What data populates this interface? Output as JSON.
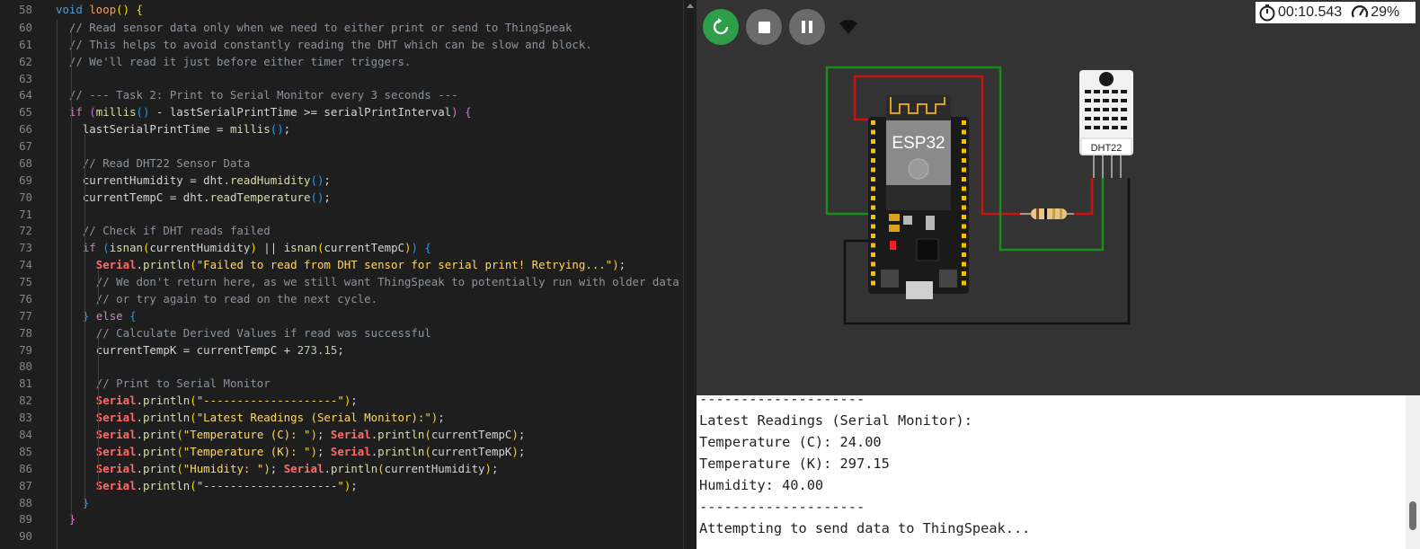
{
  "editor": {
    "lines": [
      {
        "num": "58",
        "tokens": [
          {
            "t": "void ",
            "c": "s-k"
          },
          {
            "t": "loop",
            "c": "s-fn"
          },
          {
            "t": "() ",
            "c": "s-p"
          },
          {
            "t": "{",
            "c": "s-p"
          }
        ]
      },
      {
        "num": "60",
        "tokens": [
          {
            "t": "  // Read sensor data only when we need to either print or send to ThingSpeak",
            "c": "s-cm"
          }
        ]
      },
      {
        "num": "61",
        "tokens": [
          {
            "t": "  // This helps to avoid constantly reading the DHT which can be slow and block.",
            "c": "s-cm"
          }
        ]
      },
      {
        "num": "62",
        "tokens": [
          {
            "t": "  // We'll read it just before either timer triggers.",
            "c": "s-cm"
          }
        ]
      },
      {
        "num": "63",
        "tokens": []
      },
      {
        "num": "64",
        "tokens": [
          {
            "t": "  // --- Task 2: Print to Serial Monitor every 3 seconds ---",
            "c": "s-cm"
          }
        ]
      },
      {
        "num": "65",
        "tokens": [
          {
            "t": "  ",
            "c": "s-o"
          },
          {
            "t": "if",
            "c": "s-c"
          },
          {
            "t": " (",
            "c": "s-p2"
          },
          {
            "t": "millis",
            "c": "s-f"
          },
          {
            "t": "()",
            "c": "s-p3"
          },
          {
            "t": " - lastSerialPrintTime >= serialPrintInterval",
            "c": "s-v"
          },
          {
            "t": ")",
            "c": "s-p2"
          },
          {
            "t": " {",
            "c": "s-p2"
          }
        ]
      },
      {
        "num": "66",
        "tokens": [
          {
            "t": "    lastSerialPrintTime = ",
            "c": "s-v"
          },
          {
            "t": "millis",
            "c": "s-f"
          },
          {
            "t": "()",
            "c": "s-p3"
          },
          {
            "t": ";",
            "c": "s-o"
          }
        ]
      },
      {
        "num": "67",
        "tokens": []
      },
      {
        "num": "68",
        "tokens": [
          {
            "t": "    // Read DHT22 Sensor Data",
            "c": "s-cm"
          }
        ]
      },
      {
        "num": "69",
        "tokens": [
          {
            "t": "    currentHumidity = dht.",
            "c": "s-v"
          },
          {
            "t": "readHumidity",
            "c": "s-f"
          },
          {
            "t": "()",
            "c": "s-p3"
          },
          {
            "t": ";",
            "c": "s-o"
          }
        ]
      },
      {
        "num": "70",
        "tokens": [
          {
            "t": "    currentTempC = dht.",
            "c": "s-v"
          },
          {
            "t": "readTemperature",
            "c": "s-f"
          },
          {
            "t": "()",
            "c": "s-p3"
          },
          {
            "t": ";",
            "c": "s-o"
          }
        ]
      },
      {
        "num": "71",
        "tokens": []
      },
      {
        "num": "72",
        "tokens": [
          {
            "t": "    // Check if DHT reads failed",
            "c": "s-cm"
          }
        ]
      },
      {
        "num": "73",
        "tokens": [
          {
            "t": "    ",
            "c": "s-o"
          },
          {
            "t": "if",
            "c": "s-c"
          },
          {
            "t": " (",
            "c": "s-p3"
          },
          {
            "t": "isnan",
            "c": "s-f"
          },
          {
            "t": "(",
            "c": "s-p"
          },
          {
            "t": "currentHumidity",
            "c": "s-v"
          },
          {
            "t": ")",
            "c": "s-p"
          },
          {
            "t": " || ",
            "c": "s-o"
          },
          {
            "t": "isnan",
            "c": "s-f"
          },
          {
            "t": "(",
            "c": "s-p"
          },
          {
            "t": "currentTempC",
            "c": "s-v"
          },
          {
            "t": ")",
            "c": "s-p"
          },
          {
            "t": ")",
            "c": "s-p3"
          },
          {
            "t": " {",
            "c": "s-p3"
          }
        ]
      },
      {
        "num": "74",
        "tokens": [
          {
            "t": "      ",
            "c": "s-o"
          },
          {
            "t": "Serial",
            "c": "s-cls"
          },
          {
            "t": ".",
            "c": "s-o"
          },
          {
            "t": "println",
            "c": "s-f"
          },
          {
            "t": "(",
            "c": "s-p"
          },
          {
            "t": "\"Failed to read from DHT sensor for serial print! Retrying...\"",
            "c": "s-s"
          },
          {
            "t": ")",
            "c": "s-p"
          },
          {
            "t": ";",
            "c": "s-o"
          }
        ]
      },
      {
        "num": "75",
        "tokens": [
          {
            "t": "      // We don't return here, as we still want ThingSpeak to potentially run with older data",
            "c": "s-cm"
          }
        ]
      },
      {
        "num": "76",
        "tokens": [
          {
            "t": "      // or try again to read on the next cycle.",
            "c": "s-cm"
          }
        ]
      },
      {
        "num": "77",
        "tokens": [
          {
            "t": "    ",
            "c": "s-o"
          },
          {
            "t": "}",
            "c": "s-p3"
          },
          {
            "t": " else ",
            "c": "s-c"
          },
          {
            "t": "{",
            "c": "s-p3"
          }
        ]
      },
      {
        "num": "78",
        "tokens": [
          {
            "t": "      // Calculate Derived Values if read was successful",
            "c": "s-cm"
          }
        ]
      },
      {
        "num": "79",
        "tokens": [
          {
            "t": "      currentTempK = currentTempC + ",
            "c": "s-v"
          },
          {
            "t": "273.15",
            "c": "s-n"
          },
          {
            "t": ";",
            "c": "s-o"
          }
        ]
      },
      {
        "num": "80",
        "tokens": []
      },
      {
        "num": "81",
        "tokens": [
          {
            "t": "      // Print to Serial Monitor",
            "c": "s-cm"
          }
        ]
      },
      {
        "num": "82",
        "tokens": [
          {
            "t": "      ",
            "c": "s-o"
          },
          {
            "t": "Serial",
            "c": "s-cls"
          },
          {
            "t": ".",
            "c": "s-o"
          },
          {
            "t": "println",
            "c": "s-f"
          },
          {
            "t": "(",
            "c": "s-p"
          },
          {
            "t": "\"--------------------\"",
            "c": "s-s"
          },
          {
            "t": ")",
            "c": "s-p"
          },
          {
            "t": ";",
            "c": "s-o"
          }
        ]
      },
      {
        "num": "83",
        "tokens": [
          {
            "t": "      ",
            "c": "s-o"
          },
          {
            "t": "Serial",
            "c": "s-cls"
          },
          {
            "t": ".",
            "c": "s-o"
          },
          {
            "t": "println",
            "c": "s-f"
          },
          {
            "t": "(",
            "c": "s-p"
          },
          {
            "t": "\"Latest Readings (Serial Monitor):\"",
            "c": "s-s"
          },
          {
            "t": ")",
            "c": "s-p"
          },
          {
            "t": ";",
            "c": "s-o"
          }
        ]
      },
      {
        "num": "84",
        "tokens": [
          {
            "t": "      ",
            "c": "s-o"
          },
          {
            "t": "Serial",
            "c": "s-cls"
          },
          {
            "t": ".",
            "c": "s-o"
          },
          {
            "t": "print",
            "c": "s-f"
          },
          {
            "t": "(",
            "c": "s-p"
          },
          {
            "t": "\"Temperature (C): \"",
            "c": "s-s"
          },
          {
            "t": ")",
            "c": "s-p"
          },
          {
            "t": "; ",
            "c": "s-o"
          },
          {
            "t": "Serial",
            "c": "s-cls"
          },
          {
            "t": ".",
            "c": "s-o"
          },
          {
            "t": "println",
            "c": "s-f"
          },
          {
            "t": "(",
            "c": "s-p"
          },
          {
            "t": "currentTempC",
            "c": "s-v"
          },
          {
            "t": ")",
            "c": "s-p"
          },
          {
            "t": ";",
            "c": "s-o"
          }
        ]
      },
      {
        "num": "85",
        "tokens": [
          {
            "t": "      ",
            "c": "s-o"
          },
          {
            "t": "Serial",
            "c": "s-cls"
          },
          {
            "t": ".",
            "c": "s-o"
          },
          {
            "t": "print",
            "c": "s-f"
          },
          {
            "t": "(",
            "c": "s-p"
          },
          {
            "t": "\"Temperature (K): \"",
            "c": "s-s"
          },
          {
            "t": ")",
            "c": "s-p"
          },
          {
            "t": "; ",
            "c": "s-o"
          },
          {
            "t": "Serial",
            "c": "s-cls"
          },
          {
            "t": ".",
            "c": "s-o"
          },
          {
            "t": "println",
            "c": "s-f"
          },
          {
            "t": "(",
            "c": "s-p"
          },
          {
            "t": "currentTempK",
            "c": "s-v"
          },
          {
            "t": ")",
            "c": "s-p"
          },
          {
            "t": ";",
            "c": "s-o"
          }
        ]
      },
      {
        "num": "86",
        "tokens": [
          {
            "t": "      ",
            "c": "s-o"
          },
          {
            "t": "Serial",
            "c": "s-cls"
          },
          {
            "t": ".",
            "c": "s-o"
          },
          {
            "t": "print",
            "c": "s-f"
          },
          {
            "t": "(",
            "c": "s-p"
          },
          {
            "t": "\"Humidity: \"",
            "c": "s-s"
          },
          {
            "t": ")",
            "c": "s-p"
          },
          {
            "t": "; ",
            "c": "s-o"
          },
          {
            "t": "Serial",
            "c": "s-cls"
          },
          {
            "t": ".",
            "c": "s-o"
          },
          {
            "t": "println",
            "c": "s-f"
          },
          {
            "t": "(",
            "c": "s-p"
          },
          {
            "t": "currentHumidity",
            "c": "s-v"
          },
          {
            "t": ")",
            "c": "s-p"
          },
          {
            "t": ";",
            "c": "s-o"
          }
        ]
      },
      {
        "num": "87",
        "tokens": [
          {
            "t": "      ",
            "c": "s-o"
          },
          {
            "t": "Serial",
            "c": "s-cls"
          },
          {
            "t": ".",
            "c": "s-o"
          },
          {
            "t": "println",
            "c": "s-f"
          },
          {
            "t": "(",
            "c": "s-p"
          },
          {
            "t": "\"--------------------\"",
            "c": "s-s"
          },
          {
            "t": ")",
            "c": "s-p"
          },
          {
            "t": ";",
            "c": "s-o"
          }
        ]
      },
      {
        "num": "88",
        "tokens": [
          {
            "t": "    ",
            "c": "s-o"
          },
          {
            "t": "}",
            "c": "s-p3"
          }
        ]
      },
      {
        "num": "89",
        "tokens": [
          {
            "t": "  ",
            "c": "s-o"
          },
          {
            "t": "}",
            "c": "s-p2"
          }
        ]
      },
      {
        "num": "90",
        "tokens": []
      }
    ]
  },
  "simulator": {
    "timer": "00:10.543",
    "speed": "29%",
    "chip_label": "ESP32",
    "sensor_label": "DHT22",
    "colors": {
      "restart": "#2e9e49",
      "wire_red": "#cc1111",
      "wire_green": "#1a8c1a",
      "wire_black": "#111111",
      "board": "#1a1a1a",
      "pin": "#f2c200"
    },
    "icons": {
      "restart": "restart-icon",
      "stop": "stop-icon",
      "pause": "pause-icon",
      "wifi": "wifi-icon",
      "timer": "stopwatch-icon",
      "speed": "speedometer-icon"
    }
  },
  "serial": {
    "lines": [
      "--------------------",
      "Latest Readings (Serial Monitor):",
      "Temperature (C): 24.00",
      "Temperature (K): 297.15",
      "Humidity: 40.00",
      "--------------------",
      "Attempting to send data to ThingSpeak..."
    ]
  }
}
